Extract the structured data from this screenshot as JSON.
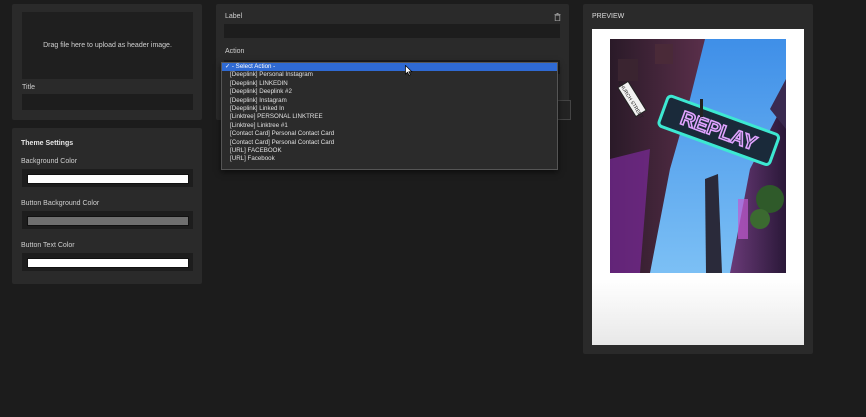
{
  "upload": {
    "dropzone_text": "Drag file here to upload as header image.",
    "title_label": "Title",
    "title_value": ""
  },
  "theme": {
    "heading": "Theme Settings",
    "background_color_label": "Background Color",
    "background_color": "#ffffff",
    "button_background_color_label": "Button Background Color",
    "button_background_color": "#6f6f6f",
    "button_text_color_label": "Button Text Color",
    "button_text_color": "#ffffff"
  },
  "link": {
    "label_label": "Label",
    "label_value": "",
    "action_label": "Action",
    "selected_action": "- Select Action -",
    "actions": [
      "- Select Action -",
      "[Deeplink] Personal Instagram",
      "[Deeplink] LINKEDIN",
      "[Deeplink] Deeplink #2",
      "[Deeplink] Instagram",
      "[Deeplink] Linked In",
      "[Linktree] PERSONAL LINKTREE",
      "[Linktree] Linktree #1",
      "[Contact Card] Personal Contact Card",
      "[Contact Card] Personal Contact Card",
      "[URL] FACEBOOK",
      "[URL] Facebook"
    ]
  },
  "preview": {
    "heading": "PREVIEW",
    "sign_text": "REPLAY",
    "street_sign_text": "CHURCH STREET"
  },
  "icons": {
    "trash": "trash-icon",
    "checkmark": "check-icon",
    "cursor": "mouse-pointer-icon"
  },
  "colors": {
    "page_background": "#1c1c1c",
    "panel_background": "#2a2a2a",
    "selection_highlight": "#2f6ad3",
    "neon_sign": "#3de8d2",
    "sky": "#5aa8f0"
  }
}
